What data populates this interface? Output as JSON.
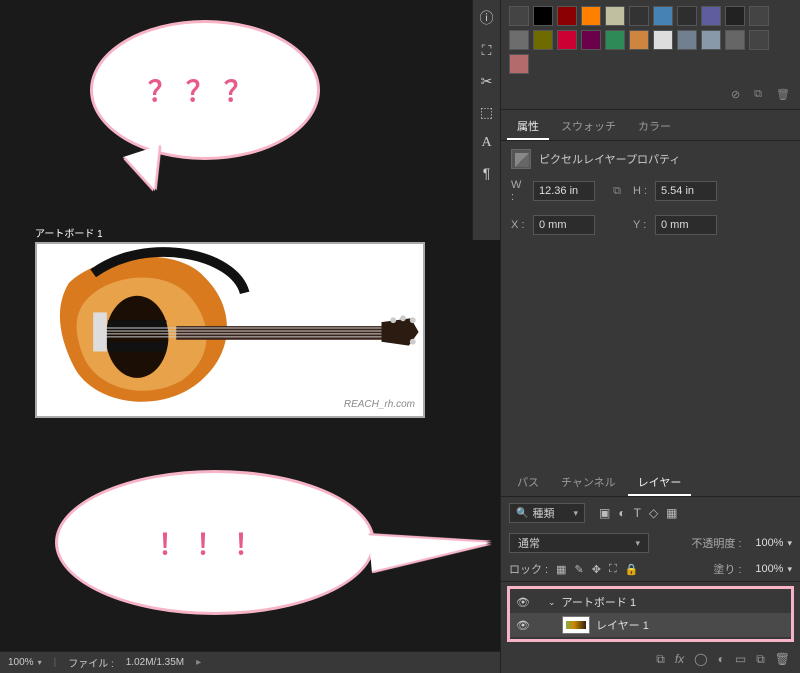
{
  "canvas": {
    "artboard_label": "アートボード 1",
    "watermark": "REACH_rh.com"
  },
  "bubbles": {
    "top_text": "？？？",
    "bottom_text": "！！！"
  },
  "icon_col": {
    "info": "ⓘ",
    "stamp": "⛶",
    "scissors": "✂",
    "cube": "⬚",
    "text": "A",
    "para": "¶"
  },
  "swatches": {
    "rows": [
      [
        "#444",
        "#000",
        "#8b0000",
        "#ff7f00",
        "#c0c0a0",
        "#333",
        "#4682b4",
        "#2e2e2e",
        "#5e5e9e",
        "#222",
        "#444"
      ],
      [
        "#6d6d6d",
        "#6e6b00",
        "#c03",
        "#6b004b",
        "#2e8b57",
        "#cd853f",
        "#ddd",
        "#708090",
        "#89a",
        "#666",
        "#444"
      ],
      [
        "#b36b6b"
      ]
    ]
  },
  "panel_footer": {
    "deny": "⊘",
    "new": "⧉",
    "trash": "🗑"
  },
  "prop_tabs": {
    "attr": "属性",
    "swatch": "スウォッチ",
    "color": "カラー"
  },
  "props": {
    "title": "ピクセルレイヤープロパティ",
    "W": "W :",
    "W_val": "12.36 in",
    "H": "H :",
    "H_val": "5.54 in",
    "X": "X :",
    "X_val": "0 mm",
    "Y": "Y :",
    "Y_val": "0 mm",
    "link": "⧉"
  },
  "layer_tabs": {
    "path": "パス",
    "channel": "チャンネル",
    "layer": "レイヤー"
  },
  "layers": {
    "search_label": "種類",
    "filters": {
      "img": "▣",
      "adj": "◐",
      "type": "T",
      "shape": "◇",
      "smart": "▦"
    },
    "blend_mode": "通常",
    "opacity_label": "不透明度 :",
    "opacity_value": "100%",
    "lock_label": "ロック :",
    "lock_icons": {
      "grid": "▦",
      "brush": "✎",
      "move": "✥",
      "crop": "⛶",
      "lock": "🔒"
    },
    "fill_label": "塗り :",
    "fill_value": "100%",
    "tree": {
      "artboard": "アートボード 1",
      "layer1": "レイヤー 1"
    },
    "bottom_icons": {
      "link": "⧉",
      "fx": "fx",
      "mask": "◯",
      "adj": "◐",
      "group": "▭",
      "new": "⧉",
      "trash": "🗑"
    }
  },
  "status": {
    "zoom": "100%",
    "file_label": "ファイル :",
    "file_value": "1.02M/1.35M"
  }
}
